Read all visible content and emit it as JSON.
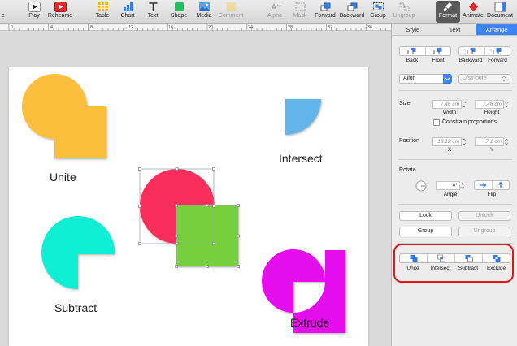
{
  "toolbar": {
    "items": [
      {
        "label": "Play"
      },
      {
        "label": "Rehearse"
      },
      {
        "label": "Table"
      },
      {
        "label": "Chart"
      },
      {
        "label": "Text"
      },
      {
        "label": "Shape"
      },
      {
        "label": "Media"
      },
      {
        "label": "Comment"
      },
      {
        "label": "Alpha"
      },
      {
        "label": "Mask"
      },
      {
        "label": "Forward"
      },
      {
        "label": "Backward"
      },
      {
        "label": "Group"
      },
      {
        "label": "Ungroup"
      },
      {
        "label": "Format"
      },
      {
        "label": "Animate"
      },
      {
        "label": "Document"
      }
    ],
    "partial_label": "e"
  },
  "ruler": {
    "ticks": [
      "0",
      "4",
      "8",
      "12",
      "16",
      "20",
      "24",
      "28",
      "32",
      "36"
    ]
  },
  "slide": {
    "captions": {
      "unite": "Unite",
      "intersect": "Intersect",
      "subtract": "Subtract",
      "extrude": "Extrude"
    },
    "colors": {
      "unite": "#fbbe3e",
      "intersect": "#62b4e9",
      "subtract": "#0ceed4",
      "extrude": "#e60ded",
      "red_circle": "#fa2d5a",
      "green_square": "#77cf3a"
    }
  },
  "inspector": {
    "tabs": [
      "Style",
      "Text",
      "Arrange"
    ],
    "active_tab": "Arrange",
    "arrange": {
      "order_labels": [
        "Back",
        "Front",
        "Backward",
        "Forward"
      ],
      "align_label": "Align",
      "distribute_label": "Distribute",
      "size": {
        "section": "Size",
        "width_value": "7.46 cm",
        "height_value": "7.46 cm",
        "width_label": "Width",
        "height_label": "Height",
        "constrain_label": "Constrain proportions",
        "constrain_checked": false
      },
      "position": {
        "section": "Position",
        "x_value": "13.12 cm",
        "y_value": "7.1 cm",
        "x_label": "X",
        "y_label": "Y"
      },
      "rotate": {
        "section": "Rotate",
        "angle_value": "0°",
        "angle_label": "Angle",
        "flip_label": "Flip"
      },
      "lock_label": "Lock",
      "unlock_label": "Unlock",
      "group_label": "Group",
      "ungroup_label": "Ungroup",
      "boolean_labels": [
        "Unite",
        "Intersect",
        "Subtract",
        "Exclude"
      ]
    }
  }
}
